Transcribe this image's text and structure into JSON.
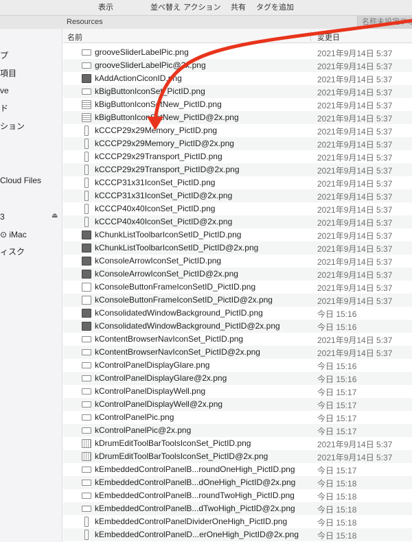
{
  "toolbar": {
    "display_label": "表示",
    "sort_label": "並べ替え",
    "action_label": "アクション",
    "share_label": "共有",
    "add_tag_label": "タグを追加"
  },
  "tabs": {
    "active": "Resources",
    "other": "名称未設定フォル"
  },
  "sidebar": {
    "items": [
      {
        "label": "プ"
      },
      {
        "label": "項目"
      },
      {
        "label": "ve"
      },
      {
        "label": "ド"
      },
      {
        "label": "ション"
      },
      {
        "label": "Cloud Files"
      },
      {
        "label": "3"
      },
      {
        "label": "⊙ iMac"
      },
      {
        "label": "ィスク"
      }
    ],
    "eject_icon": "eject-icon"
  },
  "columns": {
    "name": "名前",
    "date_modified": "変更日"
  },
  "files": [
    {
      "name": "grooveSliderLabelPic.png",
      "date": "2021年9月14日 5:37",
      "icon": "wide"
    },
    {
      "name": "grooveSliderLabelPic@2x.png",
      "date": "2021年9月14日 5:37",
      "icon": "wide"
    },
    {
      "name": "kAddActionCiconID.png",
      "date": "2021年9月14日 5:37",
      "icon": "dark"
    },
    {
      "name": "kBigButtonIconSet_PictID.png",
      "date": "2021年9月14日 5:37",
      "icon": "wide"
    },
    {
      "name": "kBigButtonIconSetNew_PictID.png",
      "date": "2021年9月14日 5:37",
      "icon": "bars"
    },
    {
      "name": "kBigButtonIconSetNew_PictID@2x.png",
      "date": "2021年9月14日 5:37",
      "icon": "bars"
    },
    {
      "name": "kCCCP29x29Memory_PictID.png",
      "date": "2021年9月14日 5:37",
      "icon": "tall"
    },
    {
      "name": "kCCCP29x29Memory_PictID@2x.png",
      "date": "2021年9月14日 5:37",
      "icon": "tall"
    },
    {
      "name": "kCCCP29x29Transport_PictID.png",
      "date": "2021年9月14日 5:37",
      "icon": "tall"
    },
    {
      "name": "kCCCP29x29Transport_PictID@2x.png",
      "date": "2021年9月14日 5:37",
      "icon": "tall"
    },
    {
      "name": "kCCCP31x31IconSet_PictID.png",
      "date": "2021年9月14日 5:37",
      "icon": "tall"
    },
    {
      "name": "kCCCP31x31IconSet_PictID@2x.png",
      "date": "2021年9月14日 5:37",
      "icon": "tall"
    },
    {
      "name": "kCCCP40x40IconSet_PictID.png",
      "date": "2021年9月14日 5:37",
      "icon": "tall"
    },
    {
      "name": "kCCCP40x40IconSet_PictID@2x.png",
      "date": "2021年9月14日 5:37",
      "icon": "tall"
    },
    {
      "name": "kChunkListToolbarIconSetID_PictID.png",
      "date": "2021年9月14日 5:37",
      "icon": "dark"
    },
    {
      "name": "kChunkListToolbarIconSetID_PictID@2x.png",
      "date": "2021年9月14日 5:37",
      "icon": "dark"
    },
    {
      "name": "kConsoleArrowIconSet_PictID.png",
      "date": "2021年9月14日 5:37",
      "icon": "dark"
    },
    {
      "name": "kConsoleArrowIconSet_PictID@2x.png",
      "date": "2021年9月14日 5:37",
      "icon": "dark"
    },
    {
      "name": "kConsoleButtonFrameIconSetID_PictID.png",
      "date": "2021年9月14日 5:37",
      "icon": "plain"
    },
    {
      "name": "kConsoleButtonFrameIconSetID_PictID@2x.png",
      "date": "2021年9月14日 5:37",
      "icon": "plain"
    },
    {
      "name": "kConsolidatedWindowBackground_PictID.png",
      "date": "今日 15:16",
      "icon": "dark"
    },
    {
      "name": "kConsolidatedWindowBackground_PictID@2x.png",
      "date": "今日 15:16",
      "icon": "dark"
    },
    {
      "name": "kContentBrowserNavIconSet_PictID.png",
      "date": "2021年9月14日 5:37",
      "icon": "wide"
    },
    {
      "name": "kContentBrowserNavIconSet_PictID@2x.png",
      "date": "2021年9月14日 5:37",
      "icon": "wide"
    },
    {
      "name": "kControlPanelDisplayGlare.png",
      "date": "今日 15:16",
      "icon": "wide"
    },
    {
      "name": "kControlPanelDisplayGlare@2x.png",
      "date": "今日 15:16",
      "icon": "wide"
    },
    {
      "name": "kControlPanelDisplayWell.png",
      "date": "今日 15:17",
      "icon": "wide"
    },
    {
      "name": "kControlPanelDisplayWell@2x.png",
      "date": "今日 15:17",
      "icon": "wide"
    },
    {
      "name": "kControlPanelPic.png",
      "date": "今日 15:17",
      "icon": "wide"
    },
    {
      "name": "kControlPanelPic@2x.png",
      "date": "今日 15:17",
      "icon": "wide"
    },
    {
      "name": "kDrumEditToolBarToolsIconSet_PictID.png",
      "date": "2021年9月14日 5:37",
      "icon": "grid"
    },
    {
      "name": "kDrumEditToolBarToolsIconSet_PictID@2x.png",
      "date": "2021年9月14日 5:37",
      "icon": "grid"
    },
    {
      "name": "kEmbeddedControlPanelB...roundOneHigh_PictID.png",
      "date": "今日 15:17",
      "icon": "wide"
    },
    {
      "name": "kEmbeddedControlPanelB...dOneHigh_PictID@2x.png",
      "date": "今日 15:18",
      "icon": "wide"
    },
    {
      "name": "kEmbeddedControlPanelB...roundTwoHigh_PictID.png",
      "date": "今日 15:18",
      "icon": "wide"
    },
    {
      "name": "kEmbeddedControlPanelB...dTwoHigh_PictID@2x.png",
      "date": "今日 15:18",
      "icon": "wide"
    },
    {
      "name": "kEmbeddedControlPanelDividerOneHigh_PictID.png",
      "date": "今日 15:18",
      "icon": "tall"
    },
    {
      "name": "kEmbeddedControlPanelD...erOneHigh_PictID@2x.png",
      "date": "今日 15:18",
      "icon": "tall"
    }
  ],
  "annotation": {
    "arrow_color": "#e8341c"
  }
}
